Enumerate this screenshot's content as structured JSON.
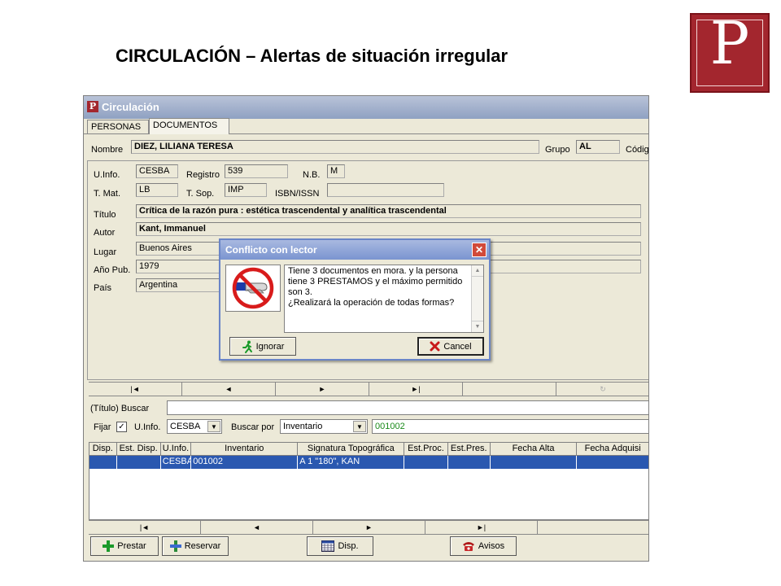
{
  "slide": {
    "title": "CIRCULACIÓN – Alertas de situación irregular",
    "logo_letter": "P"
  },
  "window": {
    "title": "Circulación",
    "app_icon": "P"
  },
  "tabs": [
    {
      "label": "PERSONAS"
    },
    {
      "label": "DOCUMENTOS",
      "active": true
    }
  ],
  "person": {
    "nombre_label": "Nombre",
    "nombre_value": "DIEZ, LILIANA TERESA",
    "grupo_label": "Grupo",
    "grupo_value": "AL",
    "codigo_label": "Códig"
  },
  "document": {
    "uinfo_label": "U.Info.",
    "uinfo_value": "CESBA",
    "registro_label": "Registro",
    "registro_value": "539",
    "nb_label": "N.B.",
    "nb_value": "M",
    "tmat_label": "T. Mat.",
    "tmat_value": "LB",
    "tsop_label": "T. Sop.",
    "tsop_value": "IMP",
    "isbn_label": "ISBN/ISSN",
    "isbn_value": "",
    "titulo_label": "Título",
    "titulo_value": "Crítica de la razón pura : estética trascendental y analítica trascendental",
    "autor_label": "Autor",
    "autor_value": "Kant, Immanuel",
    "lugar_label": "Lugar",
    "lugar_value": "Buenos Aires",
    "anio_label": "Año Pub.",
    "anio_value": "1979",
    "pais_label": "País",
    "pais_value": "Argentina"
  },
  "nav_top": [
    "|◄",
    "◄",
    "►",
    "►|",
    "",
    "↻"
  ],
  "search": {
    "titulo_buscar_label": "(Título) Buscar",
    "fijar_label": "Fijar",
    "fijar_checked": "✓",
    "uinfo_label": "U.Info.",
    "uinfo_value": "CESBA",
    "buscar_por_label": "Buscar por",
    "buscar_por_value": "Inventario",
    "codigo_value": "001002"
  },
  "grid": {
    "headers": [
      "Disp.",
      "Est. Disp.",
      "U.Info.",
      "Inventario",
      "Signatura Topográfica",
      "Est.Proc.",
      "Est.Pres.",
      "Fecha Alta",
      "Fecha Adquisi"
    ],
    "rows": [
      [
        "",
        "",
        "CESBA",
        "001002",
        "A 1 \"180\", KAN",
        "",
        "",
        "",
        ""
      ]
    ]
  },
  "nav_bottom": [
    "|◄",
    "◄",
    "►",
    "►|",
    ""
  ],
  "buttons": {
    "prestar": "Prestar",
    "reservar": "Reservar",
    "disp": "Disp.",
    "avisos": "Avisos"
  },
  "dialog": {
    "title": "Conflicto con lector",
    "close": "✕",
    "lines": [
      "Tiene 3 documentos en mora. y la persona",
      "tiene 3 PRESTAMOS y el máximo permitido",
      "son 3.",
      "¿Realizará la operación de todas formas?"
    ],
    "ignore_label": "Ignorar",
    "cancel_label": "Cancel"
  },
  "colors": {
    "logo": "#a3262e",
    "selection": "#2a58b0",
    "green_text": "#1a8a1a"
  }
}
